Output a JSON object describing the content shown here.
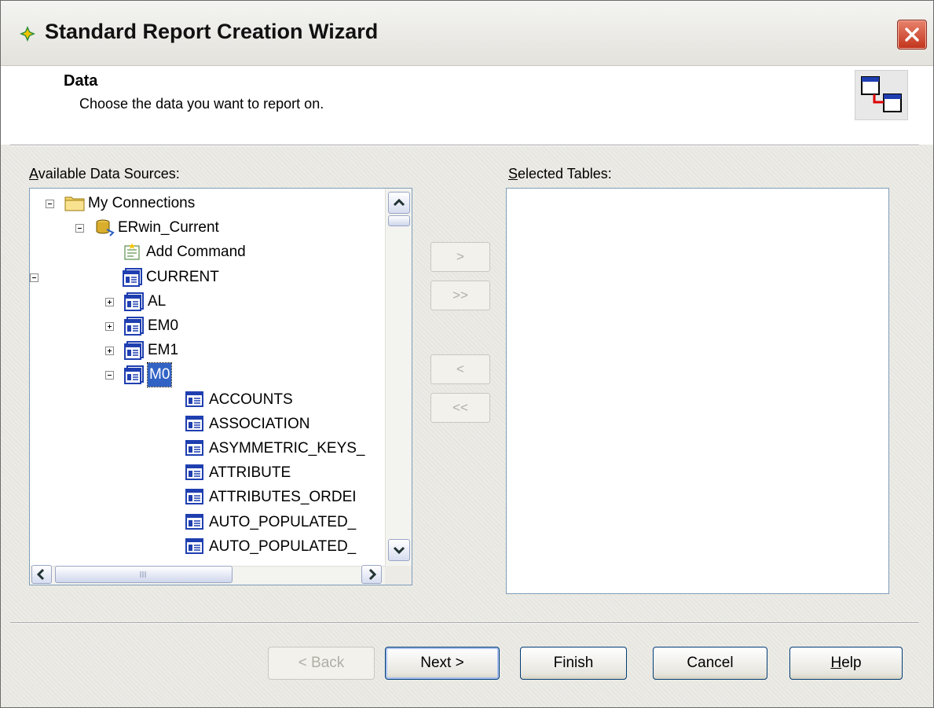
{
  "window": {
    "title": "Standard Report Creation Wizard"
  },
  "header": {
    "title": "Data",
    "subtitle": "Choose the data you want to report on."
  },
  "available": {
    "label_prefix": "A",
    "label_rest": "vailable Data Sources:",
    "tree": [
      {
        "label": "My Connections",
        "icon": "folder-icon",
        "expander": "minus"
      },
      {
        "label": "ERwin_Current",
        "icon": "database-connection-icon",
        "expander": "minus"
      },
      {
        "label": "Add Command",
        "icon": "add-command-icon",
        "expander": "none"
      },
      {
        "label": "CURRENT",
        "icon": "schema-icon",
        "expander": "minus"
      },
      {
        "label": "AL",
        "icon": "schema-icon",
        "expander": "plus"
      },
      {
        "label": "EM0",
        "icon": "schema-icon",
        "expander": "plus"
      },
      {
        "label": "EM1",
        "icon": "schema-icon",
        "expander": "plus"
      },
      {
        "label": "M0",
        "icon": "schema-icon",
        "expander": "minus",
        "selected": true
      },
      {
        "label": "ACCOUNTS",
        "icon": "table-icon",
        "expander": "none"
      },
      {
        "label": "ASSOCIATION",
        "icon": "table-icon",
        "expander": "none"
      },
      {
        "label": "ASYMMETRIC_KEYS_",
        "icon": "table-icon",
        "expander": "none"
      },
      {
        "label": "ATTRIBUTE",
        "icon": "table-icon",
        "expander": "none"
      },
      {
        "label": "ATTRIBUTES_ORDEI",
        "icon": "table-icon",
        "expander": "none"
      },
      {
        "label": "AUTO_POPULATED_",
        "icon": "table-icon",
        "expander": "none"
      },
      {
        "label": "AUTO_POPULATED_",
        "icon": "table-icon",
        "expander": "none"
      }
    ]
  },
  "selected": {
    "label_prefix": "S",
    "label_rest": "elected Tables:",
    "items": []
  },
  "transfer": {
    "add": ">",
    "add_all": ">>",
    "remove": "<",
    "remove_all": "<<"
  },
  "footer": {
    "back": "< Back",
    "next": "Next >",
    "finish": "Finish",
    "cancel": "Cancel",
    "help_prefix": "H",
    "help_rest": "elp"
  },
  "colors": {
    "selection": "#3163c5",
    "border": "#7f9db9"
  }
}
